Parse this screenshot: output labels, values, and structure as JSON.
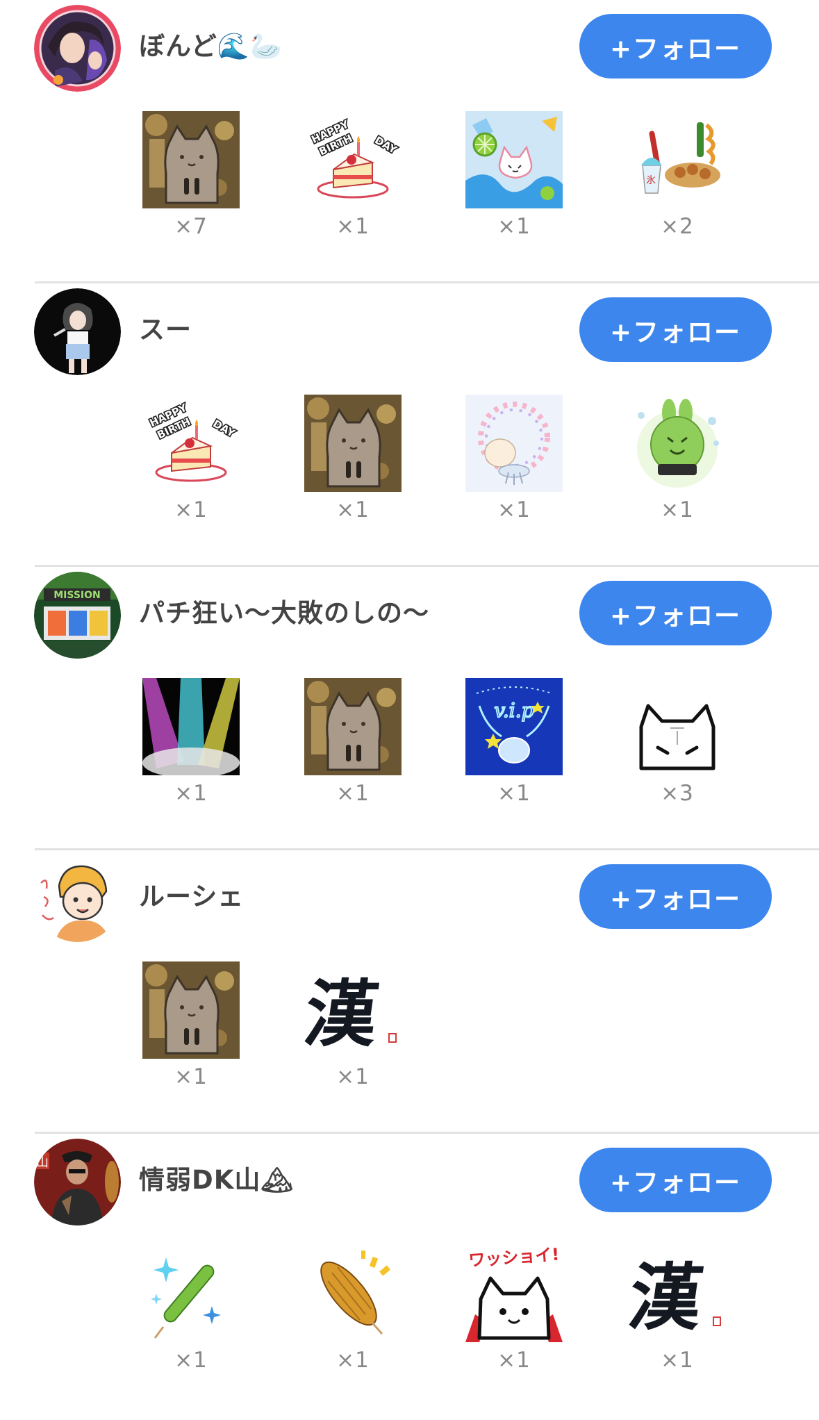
{
  "follow_label": "+フォロー",
  "entries": [
    {
      "name": "ぼんど🌊🦢",
      "gifts": [
        {
          "icon": "cat-bokeh-gift-icon",
          "count": "×7"
        },
        {
          "icon": "birthday-cake-gift-icon",
          "count": "×1"
        },
        {
          "icon": "lime-splash-cat-gift-icon",
          "count": "×1"
        },
        {
          "icon": "festival-food-gift-icon",
          "count": "×2"
        }
      ]
    },
    {
      "name": "スー",
      "gifts": [
        {
          "icon": "birthday-cake-gift-icon",
          "count": "×1"
        },
        {
          "icon": "cat-bokeh-gift-icon",
          "count": "×1"
        },
        {
          "icon": "heart-ring-jellyfish-gift-icon",
          "count": "×1"
        },
        {
          "icon": "green-rabbit-gift-icon",
          "count": "×1"
        }
      ]
    },
    {
      "name": "パチ狂い〜大敗のしの〜",
      "gifts": [
        {
          "icon": "stage-spotlights-gift-icon",
          "count": "×1"
        },
        {
          "icon": "cat-bokeh-gift-icon",
          "count": "×1"
        },
        {
          "icon": "vip-neon-gift-icon",
          "count": "×1"
        },
        {
          "icon": "peeking-cat-gift-icon",
          "count": "×3"
        }
      ]
    },
    {
      "name": "ルーシェ",
      "gifts": [
        {
          "icon": "cat-bokeh-gift-icon",
          "count": "×1"
        },
        {
          "icon": "kanji-calligraphy-gift-icon",
          "count": "×1"
        }
      ]
    },
    {
      "name": "情弱DK山🏔",
      "gifts": [
        {
          "icon": "sparkle-cucumber-gift-icon",
          "count": "×1"
        },
        {
          "icon": "grilled-corn-gift-icon",
          "count": "×1"
        },
        {
          "icon": "wasshoi-cat-gift-icon",
          "count": "×1"
        },
        {
          "icon": "kanji-calligraphy-gift-icon",
          "count": "×1"
        }
      ]
    }
  ],
  "gift_texts": {
    "happy": "HAPPY",
    "birth": "BIRTH",
    "day": "DAY",
    "vip": "v.i.p",
    "kanji": "漢",
    "wasshoi": "ワッショイ!",
    "mission": "MISSION",
    "avatar_mountain": "山",
    "tag_red": "氷"
  }
}
